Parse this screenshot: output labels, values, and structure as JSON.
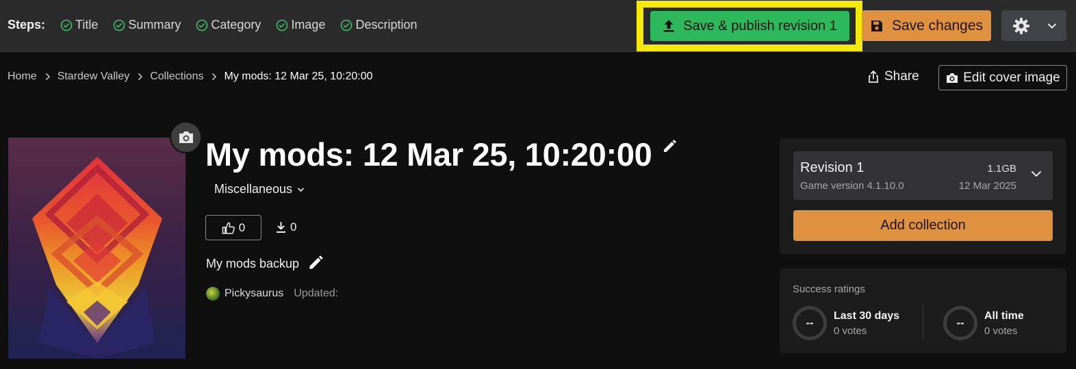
{
  "steps": {
    "label": "Steps:",
    "items": [
      {
        "label": "Title",
        "icon": "check-circle-icon"
      },
      {
        "label": "Summary",
        "icon": "check-circle-icon"
      },
      {
        "label": "Category",
        "icon": "check-circle-icon"
      },
      {
        "label": "Image",
        "icon": "check-circle-icon"
      },
      {
        "label": "Description",
        "icon": "check-circle-icon"
      }
    ]
  },
  "toolbar": {
    "publish_label": "Save & publish revision 1",
    "publish_icon": "upload-icon",
    "save_label": "Save changes",
    "save_icon": "floppy-disk-icon",
    "settings_icon": "gear-icon",
    "settings_caret": "chevron-down-icon",
    "highlight_color": "#f5e90b",
    "publish_color": "#2db95b",
    "accent_color": "#e0913f"
  },
  "breadcrumb": {
    "items": [
      "Home",
      "Stardew Valley",
      "Collections"
    ],
    "current": "My mods: 12 Mar 25, 10:20:00"
  },
  "actions": {
    "share_label": "Share",
    "edit_cover_label": "Edit cover image"
  },
  "collection": {
    "title": "My mods: 12 Mar 25, 10:20:00",
    "category": "Miscellaneous",
    "endorsements": "0",
    "downloads": "0",
    "summary": "My mods backup",
    "author": "Pickysaurus",
    "updated_label": "Updated:"
  },
  "revision": {
    "name": "Revision 1",
    "game_version": "Game version 4.1.10.0",
    "size": "1.1GB",
    "date": "12 Mar 2025",
    "add_button": "Add collection"
  },
  "ratings": {
    "title": "Success ratings",
    "items": [
      {
        "value": "--",
        "period": "Last 30 days",
        "votes": "0 votes"
      },
      {
        "value": "--",
        "period": "All time",
        "votes": "0 votes"
      }
    ]
  }
}
